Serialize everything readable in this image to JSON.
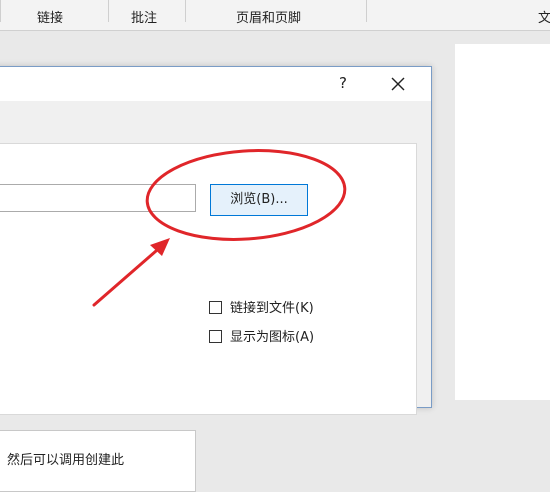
{
  "ribbon": {
    "tabs": [
      {
        "label": "链接"
      },
      {
        "label": "批注"
      },
      {
        "label": "页眉和页脚"
      },
      {
        "label": "文"
      }
    ]
  },
  "dialog": {
    "help_label": "?",
    "browse_label": "浏览(B)...",
    "checkboxes": [
      {
        "label": "链接到文件(K)",
        "checked": false
      },
      {
        "label": "显示为图标(A)",
        "checked": false
      }
    ],
    "result_text": "然后可以调用创建此"
  },
  "colors": {
    "annotation": "#e0262a",
    "dialog_border": "#7a9cc6",
    "button_focus": "#0078d7"
  }
}
